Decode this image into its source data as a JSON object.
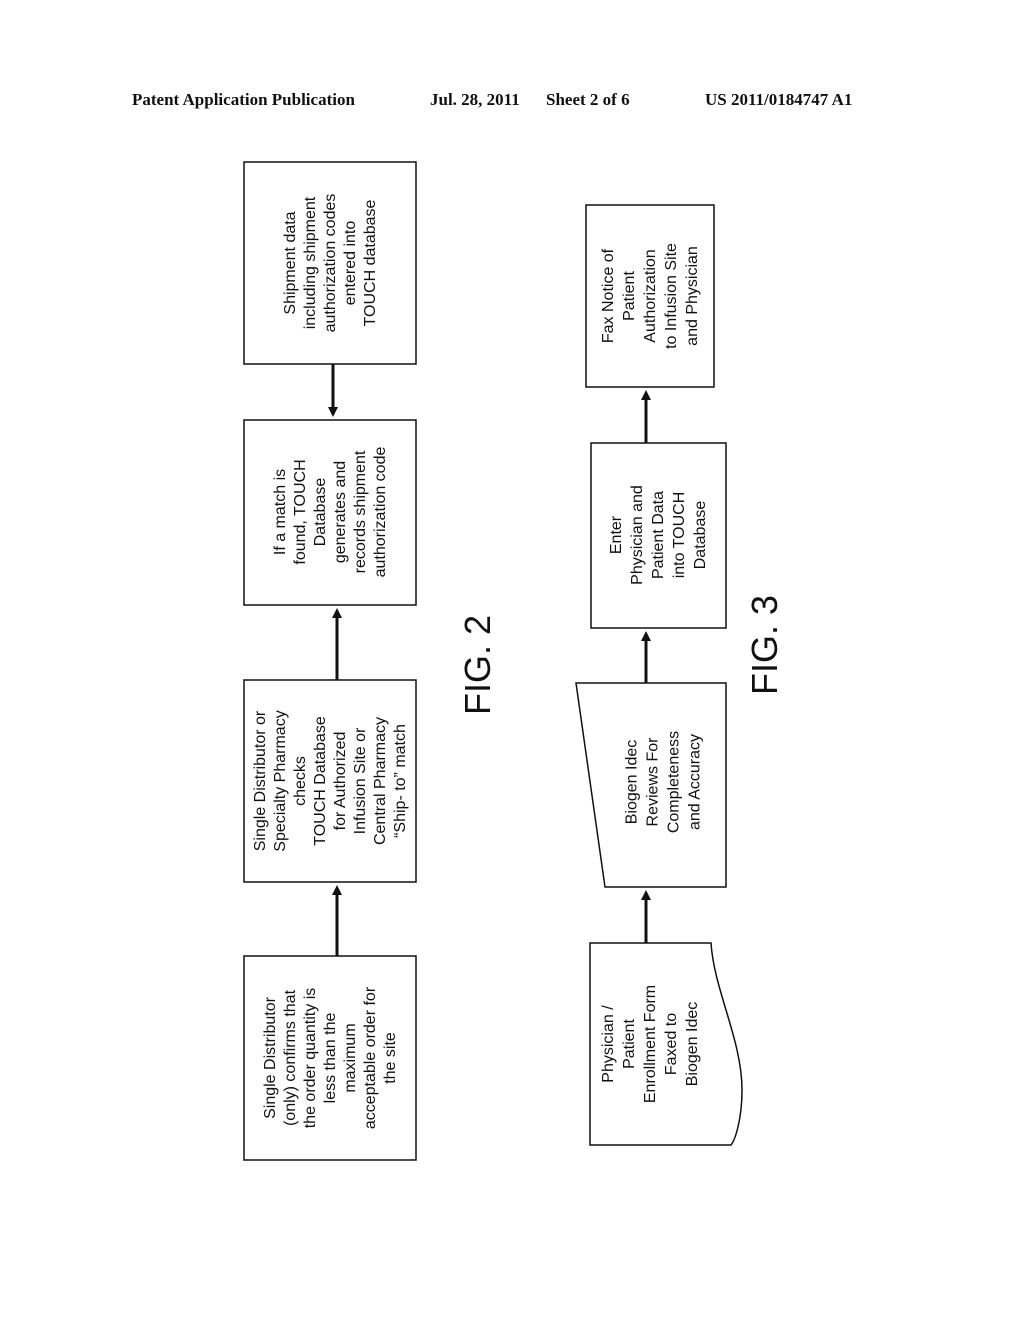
{
  "header": {
    "publication": "Patent Application Publication",
    "date": "Jul. 28, 2011",
    "sheet": "Sheet 2 of 6",
    "number": "US 2011/0184747 A1"
  },
  "fig2": {
    "label": "FIG. 2",
    "boxes": [
      {
        "lines": [
          "Single Distributor",
          "(only) confirms that",
          "the order quantity is",
          "less than the",
          "maximum",
          "acceptable order for",
          "the site"
        ]
      },
      {
        "lines": [
          "Single Distributor or",
          "Specialty Pharmacy",
          "checks",
          "TOUCH Database",
          "for Authorized",
          "Infusion Site or",
          "Central Pharmacy",
          "“Ship- to” match"
        ]
      },
      {
        "lines": [
          "If a match is",
          "found, TOUCH",
          "Database",
          "generates and",
          "records shipment",
          "authorization code"
        ]
      },
      {
        "lines": [
          "Shipment data",
          "including shipment",
          "authorization codes",
          "entered into",
          "TOUCH database"
        ]
      }
    ]
  },
  "fig3": {
    "label": "FIG. 3",
    "boxes": [
      {
        "shape": "document",
        "lines": [
          "Physician /",
          "Patient",
          "Enrollment Form",
          "Faxed to",
          "Biogen Idec"
        ]
      },
      {
        "shape": "manual-input",
        "lines": [
          "Biogen Idec",
          "Reviews For",
          "Completeness",
          "and Accuracy"
        ]
      },
      {
        "shape": "process",
        "lines": [
          "Enter",
          "Physician and",
          "Patient Data",
          "into TOUCH",
          "Database"
        ]
      },
      {
        "shape": "process",
        "lines": [
          "Fax Notice of",
          "Patient",
          "Authorization",
          "to Infusion Site",
          "and Physician"
        ]
      }
    ]
  }
}
